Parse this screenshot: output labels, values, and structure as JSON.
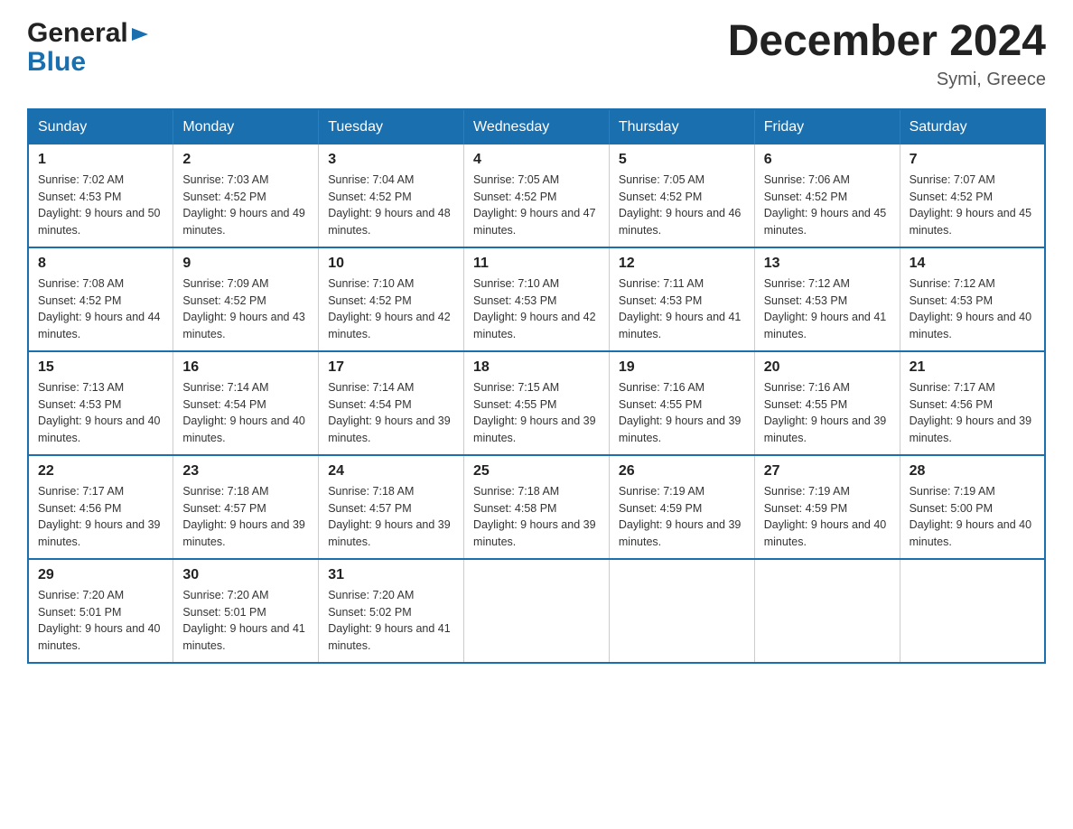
{
  "logo": {
    "general": "General",
    "blue": "Blue"
  },
  "title": "December 2024",
  "subtitle": "Symi, Greece",
  "days": [
    "Sunday",
    "Monday",
    "Tuesday",
    "Wednesday",
    "Thursday",
    "Friday",
    "Saturday"
  ],
  "weeks": [
    [
      {
        "num": "1",
        "sunrise": "7:02 AM",
        "sunset": "4:53 PM",
        "daylight": "9 hours and 50 minutes."
      },
      {
        "num": "2",
        "sunrise": "7:03 AM",
        "sunset": "4:52 PM",
        "daylight": "9 hours and 49 minutes."
      },
      {
        "num": "3",
        "sunrise": "7:04 AM",
        "sunset": "4:52 PM",
        "daylight": "9 hours and 48 minutes."
      },
      {
        "num": "4",
        "sunrise": "7:05 AM",
        "sunset": "4:52 PM",
        "daylight": "9 hours and 47 minutes."
      },
      {
        "num": "5",
        "sunrise": "7:05 AM",
        "sunset": "4:52 PM",
        "daylight": "9 hours and 46 minutes."
      },
      {
        "num": "6",
        "sunrise": "7:06 AM",
        "sunset": "4:52 PM",
        "daylight": "9 hours and 45 minutes."
      },
      {
        "num": "7",
        "sunrise": "7:07 AM",
        "sunset": "4:52 PM",
        "daylight": "9 hours and 45 minutes."
      }
    ],
    [
      {
        "num": "8",
        "sunrise": "7:08 AM",
        "sunset": "4:52 PM",
        "daylight": "9 hours and 44 minutes."
      },
      {
        "num": "9",
        "sunrise": "7:09 AM",
        "sunset": "4:52 PM",
        "daylight": "9 hours and 43 minutes."
      },
      {
        "num": "10",
        "sunrise": "7:10 AM",
        "sunset": "4:52 PM",
        "daylight": "9 hours and 42 minutes."
      },
      {
        "num": "11",
        "sunrise": "7:10 AM",
        "sunset": "4:53 PM",
        "daylight": "9 hours and 42 minutes."
      },
      {
        "num": "12",
        "sunrise": "7:11 AM",
        "sunset": "4:53 PM",
        "daylight": "9 hours and 41 minutes."
      },
      {
        "num": "13",
        "sunrise": "7:12 AM",
        "sunset": "4:53 PM",
        "daylight": "9 hours and 41 minutes."
      },
      {
        "num": "14",
        "sunrise": "7:12 AM",
        "sunset": "4:53 PM",
        "daylight": "9 hours and 40 minutes."
      }
    ],
    [
      {
        "num": "15",
        "sunrise": "7:13 AM",
        "sunset": "4:53 PM",
        "daylight": "9 hours and 40 minutes."
      },
      {
        "num": "16",
        "sunrise": "7:14 AM",
        "sunset": "4:54 PM",
        "daylight": "9 hours and 40 minutes."
      },
      {
        "num": "17",
        "sunrise": "7:14 AM",
        "sunset": "4:54 PM",
        "daylight": "9 hours and 39 minutes."
      },
      {
        "num": "18",
        "sunrise": "7:15 AM",
        "sunset": "4:55 PM",
        "daylight": "9 hours and 39 minutes."
      },
      {
        "num": "19",
        "sunrise": "7:16 AM",
        "sunset": "4:55 PM",
        "daylight": "9 hours and 39 minutes."
      },
      {
        "num": "20",
        "sunrise": "7:16 AM",
        "sunset": "4:55 PM",
        "daylight": "9 hours and 39 minutes."
      },
      {
        "num": "21",
        "sunrise": "7:17 AM",
        "sunset": "4:56 PM",
        "daylight": "9 hours and 39 minutes."
      }
    ],
    [
      {
        "num": "22",
        "sunrise": "7:17 AM",
        "sunset": "4:56 PM",
        "daylight": "9 hours and 39 minutes."
      },
      {
        "num": "23",
        "sunrise": "7:18 AM",
        "sunset": "4:57 PM",
        "daylight": "9 hours and 39 minutes."
      },
      {
        "num": "24",
        "sunrise": "7:18 AM",
        "sunset": "4:57 PM",
        "daylight": "9 hours and 39 minutes."
      },
      {
        "num": "25",
        "sunrise": "7:18 AM",
        "sunset": "4:58 PM",
        "daylight": "9 hours and 39 minutes."
      },
      {
        "num": "26",
        "sunrise": "7:19 AM",
        "sunset": "4:59 PM",
        "daylight": "9 hours and 39 minutes."
      },
      {
        "num": "27",
        "sunrise": "7:19 AM",
        "sunset": "4:59 PM",
        "daylight": "9 hours and 40 minutes."
      },
      {
        "num": "28",
        "sunrise": "7:19 AM",
        "sunset": "5:00 PM",
        "daylight": "9 hours and 40 minutes."
      }
    ],
    [
      {
        "num": "29",
        "sunrise": "7:20 AM",
        "sunset": "5:01 PM",
        "daylight": "9 hours and 40 minutes."
      },
      {
        "num": "30",
        "sunrise": "7:20 AM",
        "sunset": "5:01 PM",
        "daylight": "9 hours and 41 minutes."
      },
      {
        "num": "31",
        "sunrise": "7:20 AM",
        "sunset": "5:02 PM",
        "daylight": "9 hours and 41 minutes."
      },
      null,
      null,
      null,
      null
    ]
  ],
  "labels": {
    "sunrise": "Sunrise:",
    "sunset": "Sunset:",
    "daylight": "Daylight:"
  }
}
